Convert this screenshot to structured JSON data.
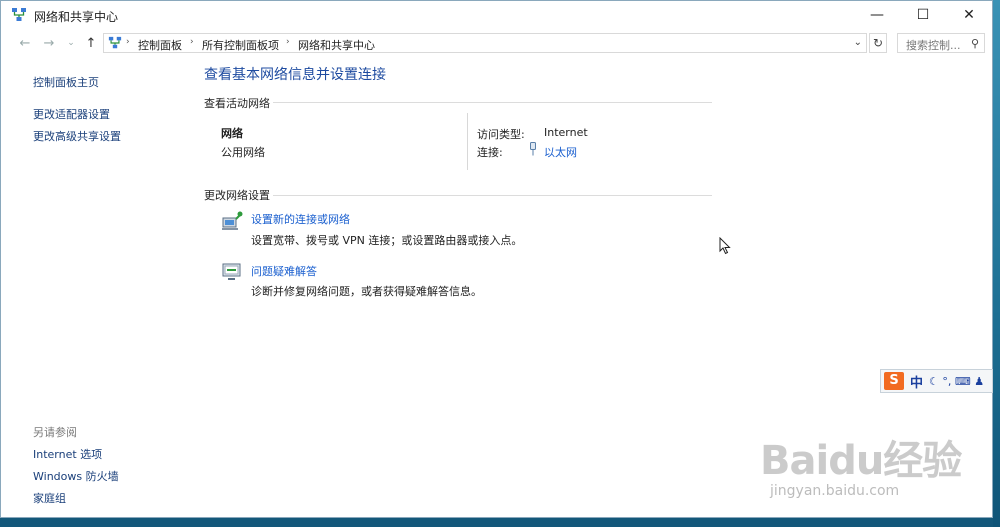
{
  "window": {
    "title": "网络和共享中心",
    "controls": {
      "minimize": "—",
      "maximize": "☐",
      "close": "✕"
    }
  },
  "address": {
    "breadcrumbs": [
      "控制面板",
      "所有控制面板项",
      "网络和共享中心"
    ],
    "search_placeholder": "搜索控制..."
  },
  "sidebar": {
    "items": [
      "控制面板主页",
      "更改适配器设置",
      "更改高级共享设置"
    ],
    "see_also_heading": "另请参阅",
    "see_also": [
      "Internet 选项",
      "Windows 防火墙",
      "家庭组"
    ]
  },
  "main": {
    "title": "查看基本网络信息并设置连接",
    "active_networks_heading": "查看活动网络",
    "network": {
      "name": "网络",
      "category": "公用网络",
      "access_type_label": "访问类型:",
      "access_type_value": "Internet",
      "connection_label": "连接:",
      "connection_value": "以太网"
    },
    "change_settings_heading": "更改网络设置",
    "tasks": [
      {
        "link": "设置新的连接或网络",
        "desc": "设置宽带、拨号或 VPN 连接；或设置路由器或接入点。"
      },
      {
        "link": "问题疑难解答",
        "desc": "诊断并修复网络问题，或者获得疑难解答信息。"
      }
    ]
  },
  "ime": {
    "logo": "S",
    "mode": "中",
    "symbols": "☾ °, ⌨ ♟"
  },
  "watermark": {
    "logo": "Baidu经验",
    "url": "jingyan.baidu.com"
  },
  "colors": {
    "link": "#1a5fcf",
    "title": "#1e4ba0",
    "desktop": "#1f6e92"
  }
}
